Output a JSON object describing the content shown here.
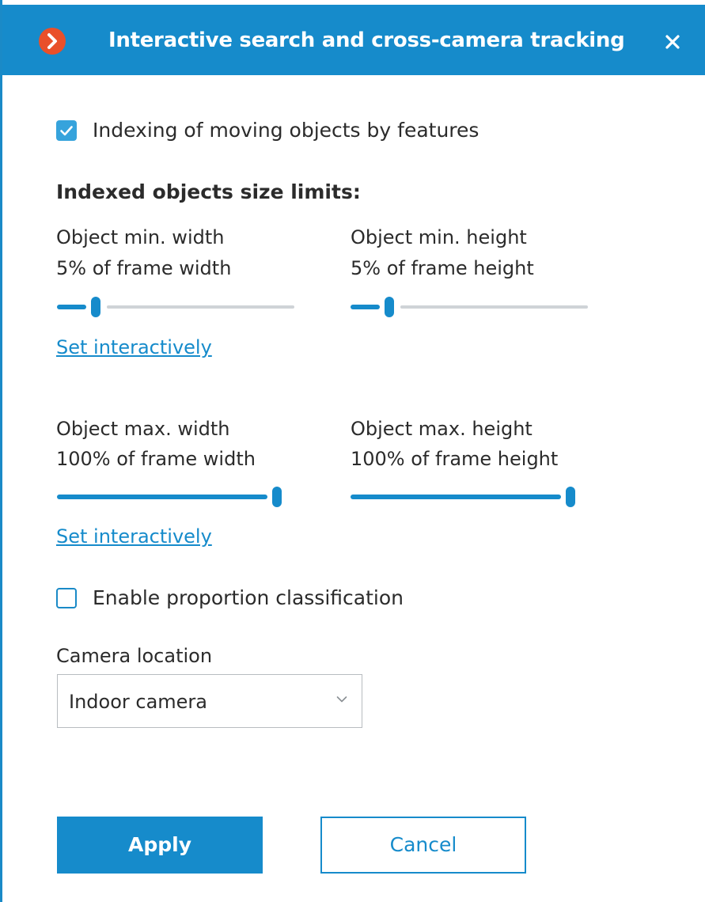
{
  "dialog": {
    "title": "Interactive search and cross-camera tracking",
    "app_icon": "chevron-right-logo-icon",
    "close_icon": "close-icon",
    "accent_color": "#168bcb",
    "logo_color": "#e9502a"
  },
  "indexing": {
    "label": "Indexing of moving objects by features",
    "checked": true
  },
  "size_limits": {
    "heading": "Indexed objects size limits:",
    "min_width": {
      "label": "Object min. width",
      "value_text": "5% of frame width",
      "percent": 5
    },
    "min_height": {
      "label": "Object min. height",
      "value_text": "5% of frame height",
      "percent": 5
    },
    "set_interactively_min": "Set interactively",
    "max_width": {
      "label": "Object max. width",
      "value_text": "100% of frame width",
      "percent": 100
    },
    "max_height": {
      "label": "Object max. height",
      "value_text": "100% of frame height",
      "percent": 100
    },
    "set_interactively_max": "Set interactively"
  },
  "proportion": {
    "label": "Enable proportion classification",
    "checked": false
  },
  "camera_location": {
    "label": "Camera location",
    "selected": "Indoor camera",
    "dropdown_icon": "chevron-down-icon"
  },
  "buttons": {
    "apply": "Apply",
    "cancel": "Cancel"
  }
}
